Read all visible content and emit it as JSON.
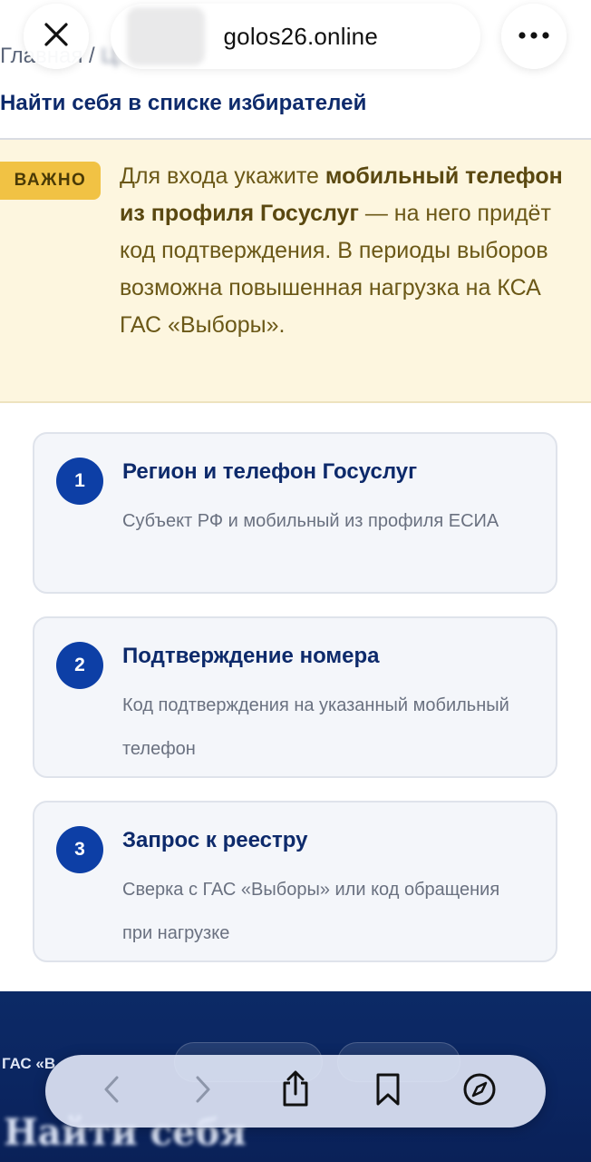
{
  "browser": {
    "url": "golos26.online"
  },
  "breadcrumb": {
    "home": "Главная",
    "separator": "/",
    "current": "Ц..."
  },
  "page": {
    "title": "Найти себя в списке избирателей"
  },
  "notice": {
    "badge": "ВАЖНО",
    "text_before": "Для входа укажите ",
    "text_bold": "мобильный телефон из профиля Госуслуг",
    "text_after": " — на него придёт код подтверждения. В периоды выборов возможна повышенная нагрузка на КСА ГАС «Выборы»."
  },
  "steps": [
    {
      "number": "1",
      "title": "Регион и телефон Госуслуг",
      "description": "Субъект РФ и мобильный из профиля ЕСИА"
    },
    {
      "number": "2",
      "title": "Подтверждение номера",
      "description": "Код подтверждения на указанный мобильный телефон"
    },
    {
      "number": "3",
      "title": "Запрос к реестру",
      "description": "Сверка с ГАС «Выборы» или код обращения при нагрузке"
    }
  ],
  "banner": {
    "label": "ГАС «В",
    "heading": "Найти себя"
  },
  "colors": {
    "primary": "#0d3fa6",
    "heading": "#0d2a6b",
    "notice_bg": "#fdf6df",
    "badge_bg": "#f1c244",
    "banner_bg": "#0c2a66"
  },
  "icons": {
    "close": "close-icon",
    "more": "more-dots-icon",
    "back": "chevron-left-icon",
    "forward": "chevron-right-icon",
    "share": "share-icon",
    "bookmarks": "bookmark-icon",
    "safari": "compass-icon"
  }
}
